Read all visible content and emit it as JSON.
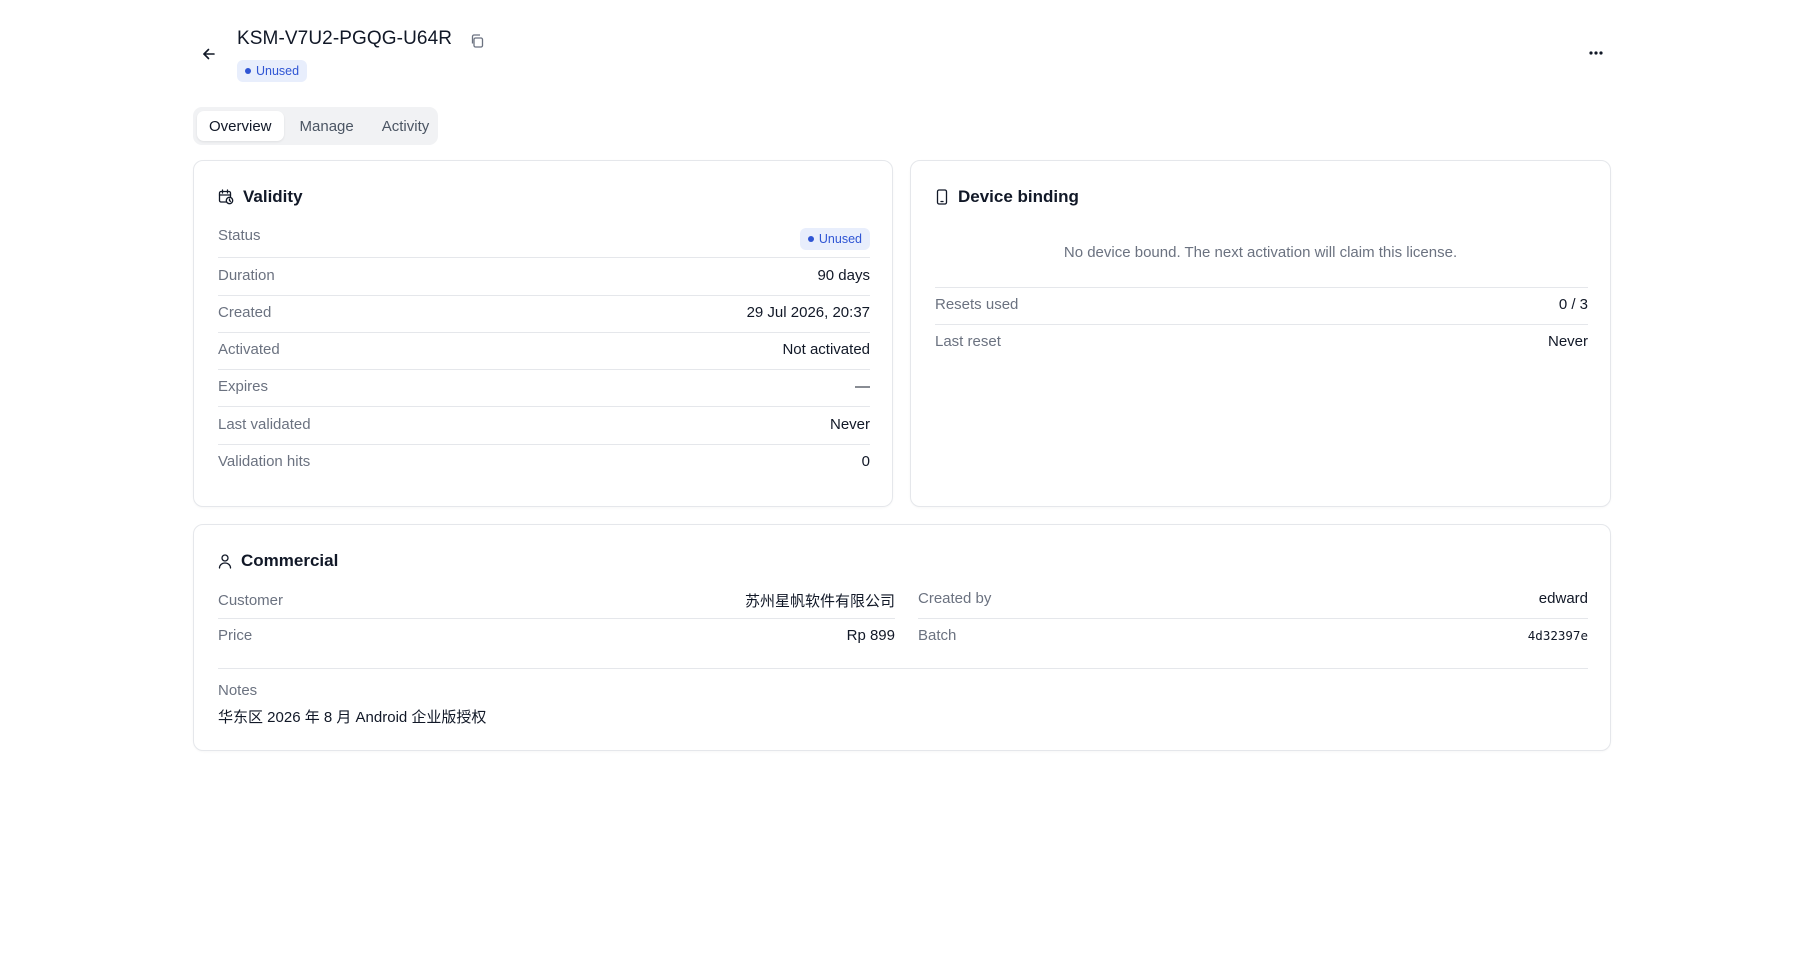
{
  "header": {
    "license_key": "KSM-V7U2-PGQG-U64R",
    "status_badge": "Unused"
  },
  "tabs": [
    {
      "label": "Overview",
      "active": true
    },
    {
      "label": "Manage",
      "active": false
    },
    {
      "label": "Activity",
      "active": false
    }
  ],
  "validity": {
    "title": "Validity",
    "status_label": "Status",
    "status_badge": "Unused",
    "rows": [
      {
        "label": "Duration",
        "value": "90 days"
      },
      {
        "label": "Created",
        "value": "29 Jul 2026, 20:37"
      },
      {
        "label": "Activated",
        "value": "Not activated"
      },
      {
        "label": "Expires",
        "value": "—"
      },
      {
        "label": "Last validated",
        "value": "Never"
      },
      {
        "label": "Validation hits",
        "value": "0"
      }
    ]
  },
  "device": {
    "title": "Device binding",
    "empty_text": "No device bound. The next activation will claim this license.",
    "rows": [
      {
        "label": "Resets used",
        "value": "0 / 3"
      },
      {
        "label": "Last reset",
        "value": "Never"
      }
    ]
  },
  "commercial": {
    "title": "Commercial",
    "left": [
      {
        "label": "Customer",
        "value": "苏州星帆软件有限公司"
      },
      {
        "label": "Price",
        "value": "Rp 899"
      }
    ],
    "right": [
      {
        "label": "Created by",
        "value": "edward"
      },
      {
        "label": "Batch",
        "value": "4d32397e"
      }
    ],
    "notes_label": "Notes",
    "notes_value": "华东区 2026 年 8 月 Android 企业版授权"
  },
  "colors": {
    "accent": "#2f55d4",
    "badge_bg": "#e8eefc",
    "border": "#e5e7eb",
    "muted_text": "#6b7280"
  },
  "icons": [
    "arrow-left-icon",
    "copy-icon",
    "more-horizontal-icon",
    "calendar-clock-icon",
    "smartphone-icon",
    "user-icon"
  ]
}
